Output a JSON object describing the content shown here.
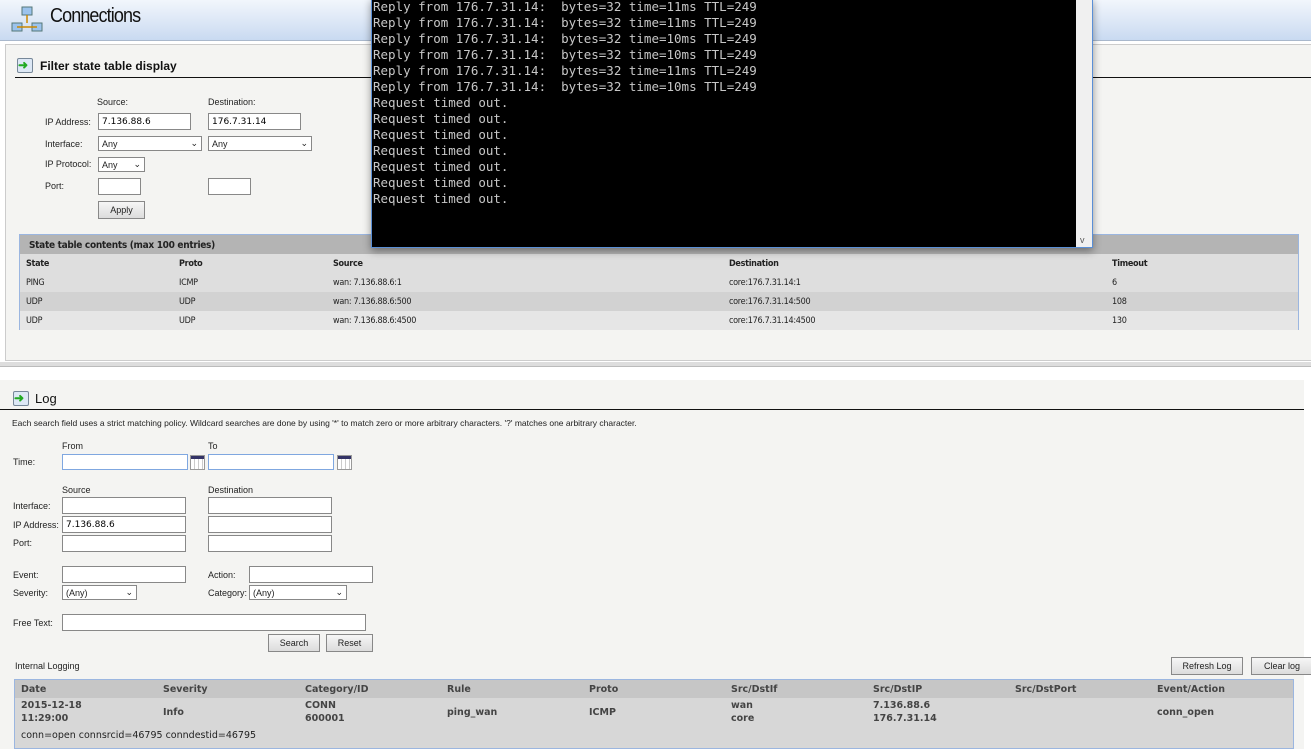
{
  "header": {
    "title": "Connections",
    "icon": "network-icon"
  },
  "filter": {
    "title": "Filter state table display",
    "source_label": "Source:",
    "destination_label": "Destination:",
    "ip_label": "IP Address:",
    "iface_label": "Interface:",
    "proto_label": "IP Protocol:",
    "port_label": "Port:",
    "src_ip": "7.136.88.6",
    "dst_ip": "176.7.31.14",
    "src_iface": "Any",
    "dst_iface": "Any",
    "proto": "Any",
    "src_port": "",
    "dst_port": "",
    "apply": "Apply"
  },
  "state_table": {
    "caption": "State table contents (max 100 entries)",
    "columns": [
      "State",
      "Proto",
      "Source",
      "Destination",
      "Timeout"
    ],
    "rows": [
      [
        "PING",
        "ICMP",
        "wan: 7.136.88.6:1",
        "core:176.7.31.14:1",
        "6"
      ],
      [
        "UDP",
        "UDP",
        "wan: 7.136.88.6:500",
        "core:176.7.31.14:500",
        "108"
      ],
      [
        "UDP",
        "UDP",
        "wan: 7.136.88.6:4500",
        "core:176.7.31.14:4500",
        "130"
      ]
    ]
  },
  "console": {
    "lines": [
      "Reply from 176.7.31.14:  bytes=32 time=11ms TTL=249",
      "Reply from 176.7.31.14:  bytes=32 time=11ms TTL=249",
      "Reply from 176.7.31.14:  bytes=32 time=10ms TTL=249",
      "Reply from 176.7.31.14:  bytes=32 time=10ms TTL=249",
      "Reply from 176.7.31.14:  bytes=32 time=11ms TTL=249",
      "Reply from 176.7.31.14:  bytes=32 time=10ms TTL=249",
      "Request timed out.",
      "Request timed out.",
      "Request timed out.",
      "Request timed out.",
      "Request timed out.",
      "Request timed out.",
      "Request timed out."
    ]
  },
  "log": {
    "title": "Log",
    "description": "Each search field uses a strict matching policy. Wildcard searches are done by using '*' to match zero or more arbitrary characters. '?' matches one arbitrary character.",
    "from_label": "From",
    "to_label": "To",
    "time_label": "Time:",
    "source_label": "Source",
    "destination_label": "Destination",
    "iface_label": "Interface:",
    "ip_label": "IP Address:",
    "port_label": "Port:",
    "src_ip": "7.136.88.6",
    "event_label": "Event:",
    "action_label": "Action:",
    "severity_label": "Severity:",
    "severity": "(Any)",
    "category_label": "Category:",
    "category": "(Any)",
    "freetext_label": "Free Text:",
    "search": "Search",
    "reset": "Reset",
    "internal_label": "Internal Logging",
    "refresh": "Refresh Log",
    "clear": "Clear log",
    "columns": [
      "Date",
      "Severity",
      "Category/ID",
      "Rule",
      "Proto",
      "Src/DstIf",
      "Src/DstIP",
      "Src/DstPort",
      "Event/Action"
    ],
    "entry": {
      "date": "2015-12-18",
      "time": "11:29:00",
      "severity": "Info",
      "category": "CONN",
      "id": "600001",
      "rule": "ping_wan",
      "proto": "ICMP",
      "src_if": "wan",
      "dst_if": "core",
      "src_ip": "7.136.88.6",
      "dst_ip": "176.7.31.14",
      "event": "conn_open",
      "details": "conn=open connsrcid=46795 conndestid=46795"
    }
  }
}
